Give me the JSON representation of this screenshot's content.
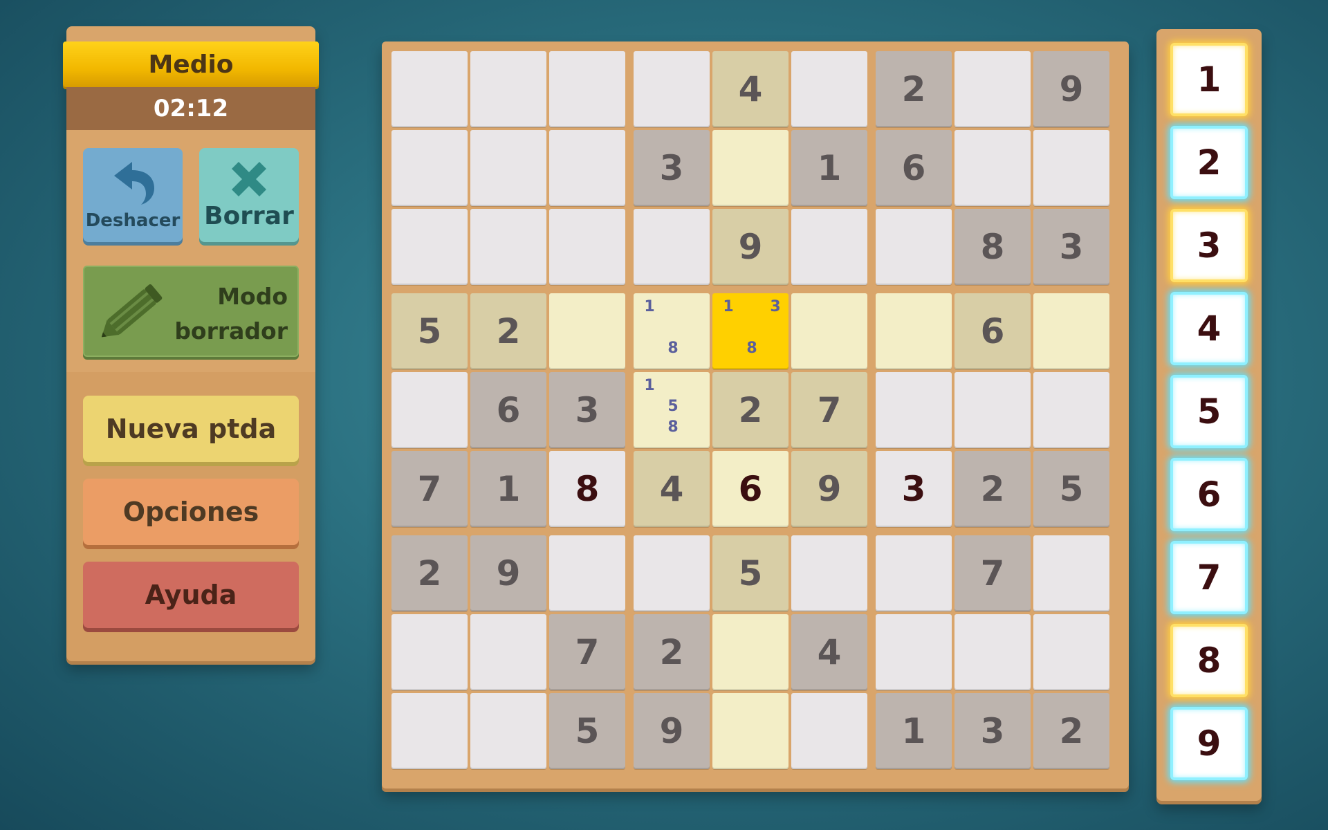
{
  "panel": {
    "difficulty": "Medio",
    "timer": "02:12",
    "undo_label": "Deshacer",
    "erase_label": "Borrar",
    "pencil_label_line1": "Modo",
    "pencil_label_line2": "borrador",
    "new_game_label": "Nueva ptda",
    "options_label": "Opciones",
    "help_label": "Ayuda"
  },
  "board": {
    "rows": [
      [
        "",
        "",
        "",
        "",
        "4",
        "",
        "2",
        "",
        "9"
      ],
      [
        "",
        "",
        "",
        "3",
        "",
        "1",
        "6",
        "",
        ""
      ],
      [
        "",
        "",
        "",
        "",
        "9",
        "",
        "",
        "8",
        "3"
      ],
      [
        "5",
        "2",
        "",
        "",
        "",
        "",
        "",
        "6",
        ""
      ],
      [
        "",
        "6",
        "3",
        "",
        "2",
        "7",
        "",
        "",
        ""
      ],
      [
        "7",
        "1",
        "8",
        "4",
        "6",
        "9",
        "3",
        "2",
        "5"
      ],
      [
        "2",
        "9",
        "",
        "",
        "5",
        "",
        "",
        "7",
        ""
      ],
      [
        "",
        "",
        "7",
        "2",
        "",
        "4",
        "",
        "",
        ""
      ],
      [
        "",
        "",
        "5",
        "9",
        "",
        "",
        "1",
        "3",
        "2"
      ]
    ],
    "user_entries": [
      [
        5,
        2
      ],
      [
        5,
        4
      ],
      [
        5,
        6
      ]
    ],
    "selected": [
      3,
      4
    ],
    "notes": [
      {
        "r": 3,
        "c": 3,
        "digits": [
          "1",
          "8"
        ]
      },
      {
        "r": 3,
        "c": 4,
        "digits": [
          "1",
          "3",
          "8"
        ]
      },
      {
        "r": 4,
        "c": 3,
        "digits": [
          "1",
          "5",
          "8"
        ]
      }
    ]
  },
  "palette": {
    "numbers": [
      "1",
      "2",
      "3",
      "4",
      "5",
      "6",
      "7",
      "8",
      "9"
    ],
    "highlight": [
      "gold",
      "blue",
      "gold",
      "blue",
      "blue",
      "blue",
      "blue",
      "gold",
      "blue"
    ]
  },
  "icons": {
    "undo": "undo-arrow-icon",
    "erase": "x-icon",
    "pencil": "pencil-icon"
  },
  "colors": {
    "selected_cell": "#ffd000",
    "highlight_cell": "#f3eec7",
    "given_cell": "#bdb4ae",
    "related_given_cell": "#d8cea6",
    "empty_cell": "#e9e6e8",
    "note_digit": "#5a5f9c",
    "user_digit": "#3b0e10"
  }
}
